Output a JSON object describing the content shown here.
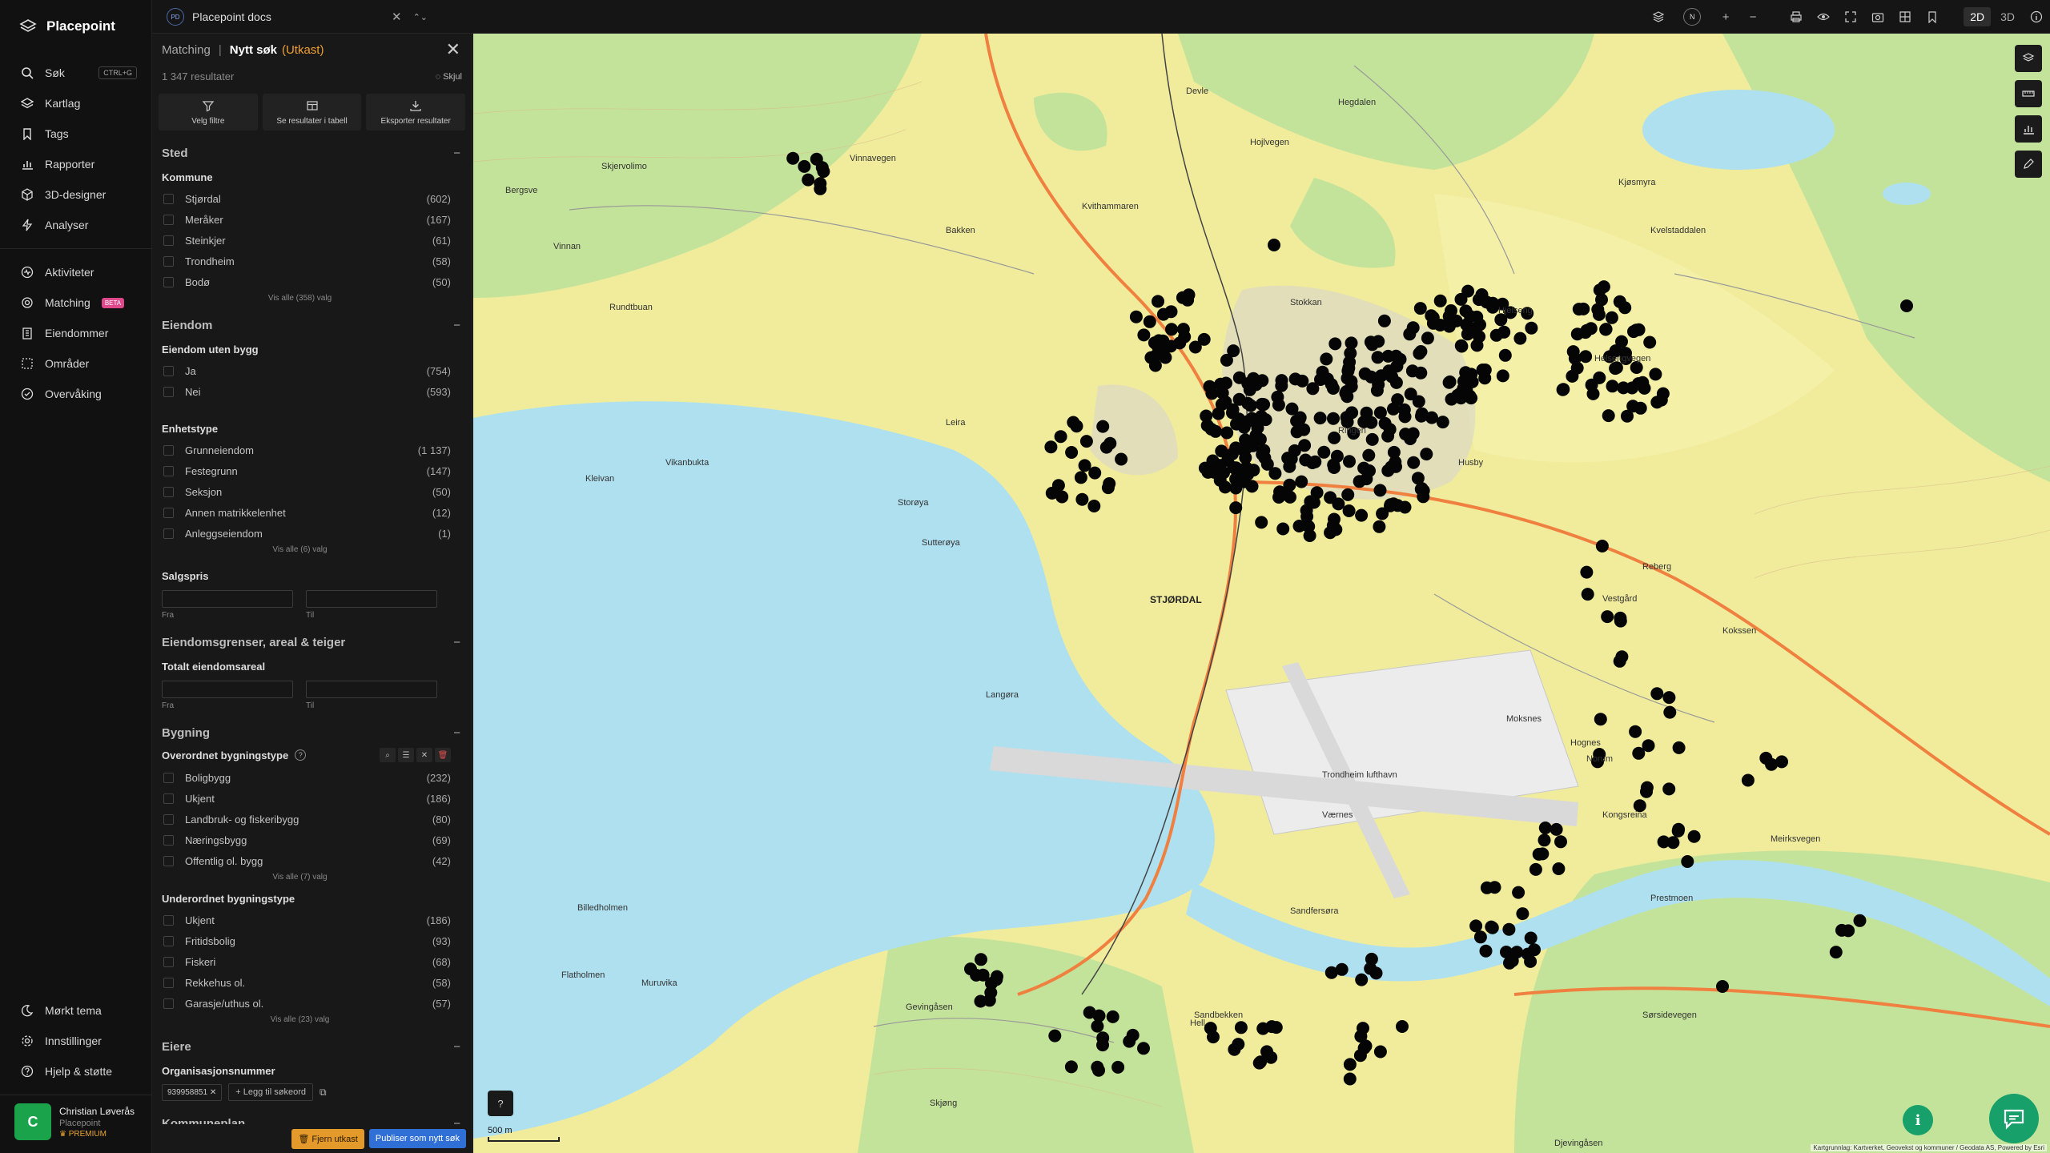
{
  "app": {
    "name": "Placepoint"
  },
  "nav": {
    "items": [
      {
        "label": "Søk",
        "shortcut": "CTRL+G"
      },
      {
        "label": "Kartlag"
      },
      {
        "label": "Tags"
      },
      {
        "label": "Rapporter"
      },
      {
        "label": "3D-designer"
      },
      {
        "label": "Analyser"
      }
    ],
    "items2": [
      {
        "label": "Aktiviteter"
      },
      {
        "label": "Matching",
        "badge": "BETA"
      },
      {
        "label": "Eiendommer"
      },
      {
        "label": "Områder"
      },
      {
        "label": "Overvåking"
      }
    ],
    "bottom": [
      {
        "label": "Mørkt tema"
      },
      {
        "label": "Innstillinger"
      },
      {
        "label": "Hjelp & støtte"
      }
    ],
    "user": {
      "initial": "C",
      "name": "Christian Løverås",
      "org": "Placepoint",
      "plan": "PREMIUM"
    }
  },
  "topbar": {
    "doc_badge": "PD",
    "doc_name": "Placepoint docs",
    "north": "N",
    "view2d": "2D",
    "view3d": "3D"
  },
  "panel": {
    "crumb": "Matching",
    "title": "Nytt søk",
    "draft": "(Utkast)",
    "results": "1 347 resultater",
    "hide": "Skjul",
    "actions": [
      "Velg filtre",
      "Se resultater i tabell",
      "Eksporter resultater"
    ],
    "sted": {
      "title": "Sted",
      "kommune": "Kommune",
      "options": [
        {
          "label": "Stjørdal",
          "count": "(602)"
        },
        {
          "label": "Meråker",
          "count": "(167)"
        },
        {
          "label": "Steinkjer",
          "count": "(61)"
        },
        {
          "label": "Trondheim",
          "count": "(58)"
        },
        {
          "label": "Bodø",
          "count": "(50)"
        }
      ],
      "more": "Vis alle (358) valg"
    },
    "eiendom": {
      "title": "Eiendom",
      "uten_bygg": "Eiendom uten bygg",
      "uten_options": [
        {
          "label": "Ja",
          "count": "(754)"
        },
        {
          "label": "Nei",
          "count": "(593)"
        }
      ],
      "enhetstype": "Enhetstype",
      "enhet_options": [
        {
          "label": "Grunneiendom",
          "count": "(1 137)"
        },
        {
          "label": "Festegrunn",
          "count": "(147)"
        },
        {
          "label": "Seksjon",
          "count": "(50)"
        },
        {
          "label": "Annen matrikkelenhet",
          "count": "(12)"
        },
        {
          "label": "Anleggseiendom",
          "count": "(1)"
        }
      ],
      "enhet_more": "Vis alle (6) valg",
      "salgspris": "Salgspris",
      "fra": "Fra",
      "til": "Til"
    },
    "grenser": {
      "title": "Eiendomsgrenser, areal & teiger",
      "areal": "Totalt eiendomsareal",
      "fra": "Fra",
      "til": "Til"
    },
    "bygning": {
      "title": "Bygning",
      "overordnet": "Overordnet bygningstype",
      "over_options": [
        {
          "label": "Boligbygg",
          "count": "(232)"
        },
        {
          "label": "Ukjent",
          "count": "(186)"
        },
        {
          "label": "Landbruk- og fiskeribygg",
          "count": "(80)"
        },
        {
          "label": "Næringsbygg",
          "count": "(69)"
        },
        {
          "label": "Offentlig ol. bygg",
          "count": "(42)"
        }
      ],
      "over_more": "Vis alle (7) valg",
      "underordnet": "Underordnet bygningstype",
      "under_options": [
        {
          "label": "Ukjent",
          "count": "(186)"
        },
        {
          "label": "Fritidsbolig",
          "count": "(93)"
        },
        {
          "label": "Fiskeri",
          "count": "(68)"
        },
        {
          "label": "Rekkehus ol.",
          "count": "(58)"
        },
        {
          "label": "Garasje/uthus ol.",
          "count": "(57)"
        }
      ],
      "under_more": "Vis alle (23) valg"
    },
    "eiere": {
      "title": "Eiere",
      "org": "Organisasjonsnummer",
      "tag": "939958851",
      "add": "Legg til søkeord"
    },
    "kommuneplan": {
      "title": "Kommuneplan"
    },
    "footer": {
      "remove": "Fjern utkast",
      "publish": "Publiser som nytt søk"
    }
  },
  "map": {
    "scale": "500 m",
    "attribution": "Kartgrunnlag: Kartverket, Geovekst og kommuner / Geodata AS, Powered by Esri",
    "places": [
      "Vinnavegen",
      "Devle",
      "Hojlvegen",
      "Hegdalen",
      "Kvithammaren",
      "Bakken",
      "Skjervolimo",
      "Rundtbuan",
      "Vinnan",
      "Stokkan",
      "Hjelseng",
      "Helsengvegen",
      "Kjøsmyra",
      "Kvelstaddalen",
      "Bergsve",
      "Leira",
      "Ringen",
      "Husby",
      "Kleivan",
      "Vikanbukta",
      "Storøya",
      "Sutterøya",
      "STJØRDAL",
      "Reberg",
      "Vestgård",
      "Kokssen",
      "Langøra",
      "Trondheim lufthavn",
      "Værnes",
      "Moksnes",
      "Hognes",
      "Norum",
      "Kongsreina",
      "Meirksvegen",
      "Billedholmen",
      "Sandfersøra",
      "Gevingåsen",
      "Sandbekken",
      "Prestmoen",
      "Sørsidevegen",
      "Muruvika",
      "Flatholmen",
      "Skjøng",
      "Djevingåsen",
      "Hell"
    ]
  }
}
